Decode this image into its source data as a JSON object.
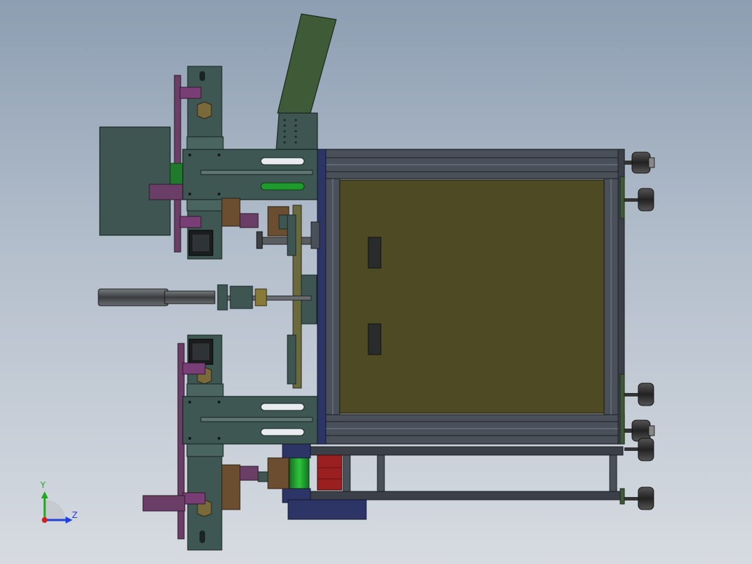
{
  "viewport": {
    "background_top": "#8d9eb2",
    "background_bottom": "#d7dbe1"
  },
  "colors": {
    "frame_steel": "#3a3f48",
    "frame_light": "#5b6270",
    "panel_olive": "#4d4a24",
    "bracket_teal": "#3f5752",
    "plate_purple": "#6a3e66",
    "guard_green": "#3f5a36",
    "roller_green": "#1f9a2c",
    "cylinder_gray": "#5a5d60",
    "accent_red": "#9a1f1f",
    "block_navy": "#2c3566",
    "bronze": "#6b4e2f",
    "cover_slate": "#3e5552"
  },
  "triad": {
    "y_label": "Y",
    "z_label": "Z",
    "y_color": "#1fa81f",
    "z_color": "#2040d8",
    "x_color": "#d01f1f"
  }
}
